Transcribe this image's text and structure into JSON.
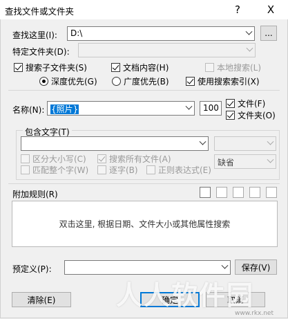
{
  "window": {
    "title": "查找文件或文件夹",
    "help_label": "?",
    "close_label": "X"
  },
  "search_in": {
    "label": "查找这里(I):",
    "value": "D:\\",
    "browse_label": "..."
  },
  "specific_folder": {
    "label": "特定文件夹(D):",
    "value": ""
  },
  "options_row1": {
    "search_subfolders": {
      "label": "搜索子文件夹(S)",
      "checked": true
    },
    "doc_content": {
      "label": "文档内容(H)",
      "checked": true
    },
    "local_search": {
      "label": "本地搜索(L)",
      "checked": false,
      "disabled": true
    }
  },
  "options_row2": {
    "depth_first": {
      "label": "深度优先(G)",
      "checked": true
    },
    "breadth_first": {
      "label": "广度优先(B)",
      "checked": false
    },
    "use_index": {
      "label": "使用搜索索引(X)",
      "checked": true
    }
  },
  "name": {
    "label": "名称(N):",
    "value": "{照片}",
    "limit": "100"
  },
  "types": {
    "file": {
      "label": "文件(F)",
      "checked": true
    },
    "folder": {
      "label": "文件夹(O)",
      "checked": true
    }
  },
  "contains": {
    "label": "包含文字(T)",
    "value": "",
    "encoding_value": "",
    "case_sensitive": {
      "label": "区分大小写(C)",
      "checked": false
    },
    "search_all_files": {
      "label": "搜索所有文件(A)",
      "checked": true
    },
    "whole_word": {
      "label": "匹配整个字(W)",
      "checked": false
    },
    "byte": {
      "label": "逐字(B)",
      "checked": false
    },
    "regex": {
      "label": "正则表达式(E)",
      "checked": false
    },
    "default_value": "缺省"
  },
  "rules": {
    "label": "附加规则(R)",
    "hint": "双击这里, 根据日期、文件大小或其他属性搜索"
  },
  "predefined": {
    "label": "预定义(P):",
    "value": "",
    "save_label": "保存(V)"
  },
  "footer": {
    "clear_label": "清除(E)",
    "ok_label": "确定",
    "cancel_label": "取消"
  },
  "watermark": {
    "text": "人人软件园",
    "url": "www.rkx.net"
  }
}
